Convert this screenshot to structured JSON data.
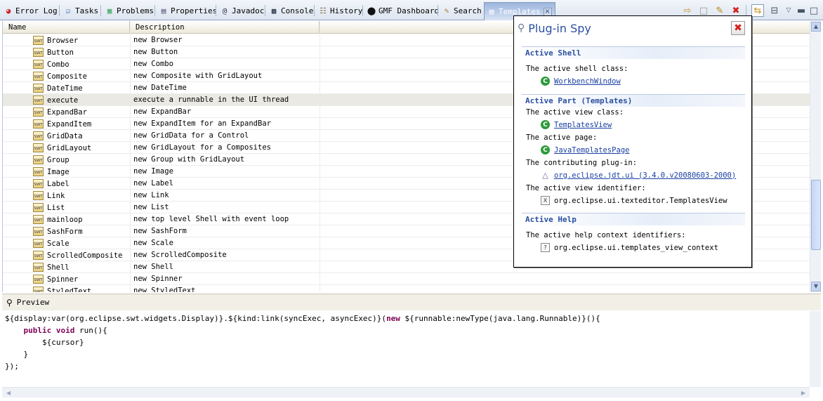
{
  "tabs": [
    {
      "label": "Error Log",
      "icon": "error-log-icon"
    },
    {
      "label": "Tasks",
      "icon": "tasks-icon"
    },
    {
      "label": "Problems",
      "icon": "problems-icon"
    },
    {
      "label": "Properties",
      "icon": "properties-icon"
    },
    {
      "label": "Javadoc",
      "icon": "javadoc-icon"
    },
    {
      "label": "Console",
      "icon": "console-icon"
    },
    {
      "label": "History",
      "icon": "history-icon"
    },
    {
      "label": "GMF Dashboard",
      "icon": "gmf-dashboard-icon"
    },
    {
      "label": "Search",
      "icon": "search-icon"
    },
    {
      "label": "Templates",
      "icon": "templates-icon"
    }
  ],
  "table": {
    "headers": [
      "Name",
      "Description"
    ],
    "rows": [
      {
        "name": "Browser",
        "desc": "new Browser"
      },
      {
        "name": "Button",
        "desc": "new Button"
      },
      {
        "name": "Combo",
        "desc": "new Combo"
      },
      {
        "name": "Composite",
        "desc": "new Composite with GridLayout"
      },
      {
        "name": "DateTime",
        "desc": "new DateTime"
      },
      {
        "name": "execute",
        "desc": "execute a runnable in the UI thread"
      },
      {
        "name": "ExpandBar",
        "desc": "new ExpandBar"
      },
      {
        "name": "ExpandItem",
        "desc": "new ExpandItem for an ExpandBar"
      },
      {
        "name": "GridData",
        "desc": "new GridData for a Control"
      },
      {
        "name": "GridLayout",
        "desc": "new GridLayout for a Composites"
      },
      {
        "name": "Group",
        "desc": "new Group with GridLayout"
      },
      {
        "name": "Image",
        "desc": "new Image"
      },
      {
        "name": "Label",
        "desc": "new Label"
      },
      {
        "name": "Link",
        "desc": "new Link"
      },
      {
        "name": "List",
        "desc": "new List"
      },
      {
        "name": "mainloop",
        "desc": "new top level Shell with event loop"
      },
      {
        "name": "SashForm",
        "desc": "new SashForm"
      },
      {
        "name": "Scale",
        "desc": "new Scale"
      },
      {
        "name": "ScrolledComposite",
        "desc": "new ScrolledComposite"
      },
      {
        "name": "Shell",
        "desc": "new Shell"
      },
      {
        "name": "Spinner",
        "desc": "new Spinner"
      },
      {
        "name": "StyledText",
        "desc": "new StyledText"
      }
    ],
    "selected_index": 5,
    "row_icon_text": "SWT"
  },
  "preview": {
    "label": "Preview",
    "code": {
      "l1a": "${display:var(org.eclipse.swt.widgets.Display)}.${kind:link(syncExec, asyncExec)}(",
      "l1kw": "new",
      "l1b": " ${runnable:newType(java.lang.Runnable)}(){",
      "l2kw": "public void",
      "l2b": " run(){",
      "l3": "${cursor}",
      "l4": "}",
      "l5": "});"
    }
  },
  "spy": {
    "title": "Plug-in Spy",
    "active_shell": {
      "heading": "Active Shell",
      "class_label": "The active shell class:",
      "class_value": "WorkbenchWindow"
    },
    "active_part": {
      "heading": "Active Part (Templates)",
      "view_class_label": "The active view class:",
      "view_class_value": "TemplatesView",
      "page_label": "The active page:",
      "page_value": "JavaTemplatesPage",
      "plugin_label": "The contributing plug-in:",
      "plugin_value": "org.eclipse.jdt.ui (3.4.0.v20080603-2000)",
      "view_id_label": "The active view identifier:",
      "view_id_value": "org.eclipse.ui.texteditor.TemplatesView"
    },
    "active_help": {
      "heading": "Active Help",
      "ctx_label": "The active help context identifiers:",
      "ctx_value": "org.eclipse.ui.templates_view_context"
    }
  },
  "colors": {
    "accent": "#2a4fa0",
    "keyword": "#7f0055",
    "close_red": "#d6201f",
    "selected_row": "#ebe9e3"
  }
}
